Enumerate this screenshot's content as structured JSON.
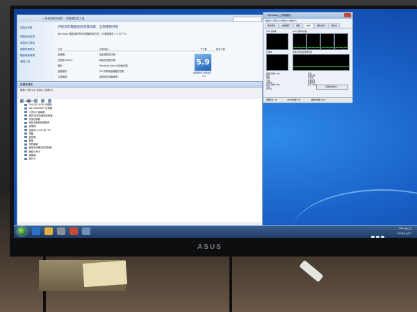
{
  "monitor": {
    "brand": "ASUS"
  },
  "control_panel": {
    "breadcrumb": "« 所有控制台項目 › 效能資訊及工具",
    "sidebar": [
      "控制台首頁",
      "調整視覺效果",
      "調整索引選項",
      "調整電源設定",
      "開啟磁碟清理",
      "進階工具"
    ],
    "title": "評等您的電腦並改善其效能：全部重新評等",
    "subtitle": "Windows 體驗指數會評估關鍵系統元件，分數範圍從 1.0 到 7.9。",
    "headers": {
      "component": "元件",
      "rating": "評等項目",
      "subscore": "子分數",
      "base": "基本分數"
    },
    "rows": [
      {
        "component": "處理器:",
        "desc": "每秒運算的次數",
        "score": "7.1"
      },
      {
        "component": "記憶體 (RAM):",
        "desc": "每秒記憶體作業",
        "score": "7.1"
      },
      {
        "component": "圖形:",
        "desc": "Windows Aero 的桌面效能",
        "score": "5.9"
      },
      {
        "component": "遊戲圖形:",
        "desc": "3D 商業與遊戲圖形效能",
        "score": "6.6"
      },
      {
        "component": "主要硬碟:",
        "desc": "磁碟資料傳輸速率",
        "score": "5.9"
      }
    ],
    "base_score": "5.9",
    "base_caption": "由最低的子分數決定"
  },
  "device_manager": {
    "title": "裝置管理員",
    "menu": "檔案(F)  執行(A)  檢視(V)  說明(H)",
    "nodes": [
      "USER-PC",
      "DVD/CD-ROM 光碟機",
      "IDE ATA/ATAPI 控制器",
      "人性化介面裝置",
      "音效,視訊及遊戲控制器",
      "存放控制器",
      "滑鼠及其他指標裝置",
      "處理器",
      "連接埠 (COM 和 LPT)",
      "電腦",
      "監視器",
      "鍵盤",
      "系統裝置",
      "通用序列匯流排控制器",
      "網路介面卡",
      "磁碟機",
      "顯示卡"
    ]
  },
  "task_manager": {
    "title": "Windows 工作管理員",
    "menu": "檔案(F)  選項(O)  檢視(V)  說明(H)",
    "tabs": [
      "應用程式",
      "處理程序",
      "服務",
      "效能",
      "網路功能",
      "使用者"
    ],
    "selected_tab": "效能",
    "cpu_usage_label": "CPU 使用率",
    "cpu_history_label": "CPU 使用率記錄",
    "memory_label": "記憶體",
    "memory_history_label": "實體記憶體使用量記錄",
    "cpu_cores": 4,
    "stats_left": [
      "實體記憶體 (MB)",
      "總計",
      "快取",
      "可用",
      "未使用",
      "核心記憶體 (MB)",
      "分頁",
      "非分頁"
    ],
    "stats_right": [
      "系統",
      "控制代碼",
      "執行緒",
      "處理程序",
      "存留時間",
      "認可 (MB)"
    ],
    "resource_button": "資源監視器(R)...",
    "status": {
      "processes": "處理程序: 46",
      "cpu": "CPU 使用率: 1%",
      "memory": "實體記憶體: 20%"
    }
  },
  "taskbar": {
    "time": "下午 06:21",
    "date": "2013/10/27"
  }
}
